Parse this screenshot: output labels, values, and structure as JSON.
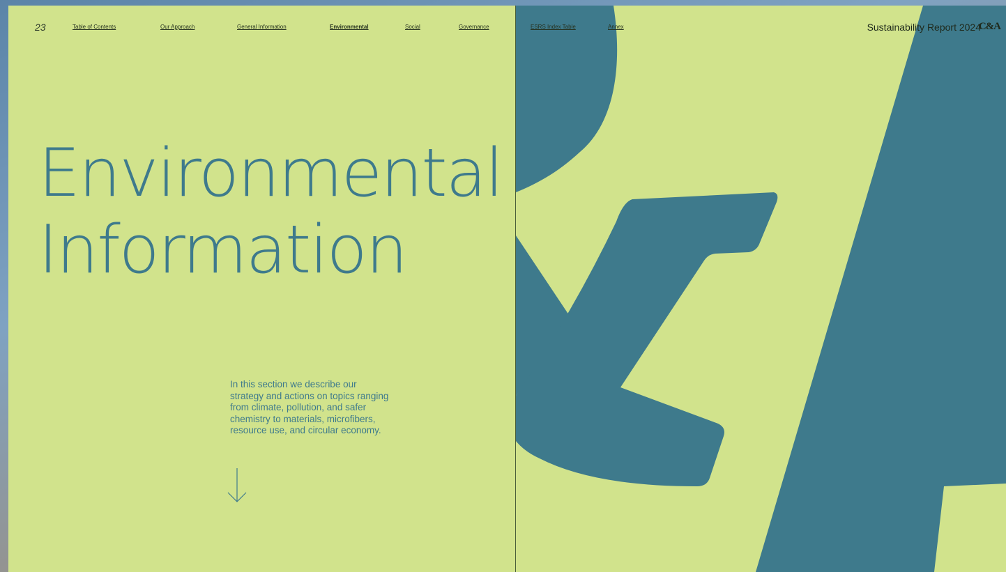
{
  "page_number": "23",
  "nav": {
    "items": [
      {
        "label": "Table of Contents",
        "active": false
      },
      {
        "label": "Our Approach",
        "active": false
      },
      {
        "label": "General Information",
        "active": false
      },
      {
        "label": "Environmental",
        "active": true
      },
      {
        "label": "Social",
        "active": false
      },
      {
        "label": "Governance",
        "active": false
      },
      {
        "label": "ESRS Index Table",
        "active": false
      },
      {
        "label": "Annex",
        "active": false
      }
    ]
  },
  "report_title": "Sustainability Report 2024",
  "logo_text": "C&A",
  "heading": {
    "line1": "Environmental",
    "line2": "Information"
  },
  "intro_text": "In this section we describe our strategy and actions on topics ranging from climate, pollution, and safer chemistry to materials, microfibers, resource use, and circular economy.",
  "colors": {
    "page_background": "#d1e38c",
    "accent_teal": "#3e7a8c",
    "text_dark": "#1f2a1c"
  },
  "icons": {
    "down_arrow": "arrow-down-icon",
    "ampersand_graphic": "ampersand-graphic"
  }
}
